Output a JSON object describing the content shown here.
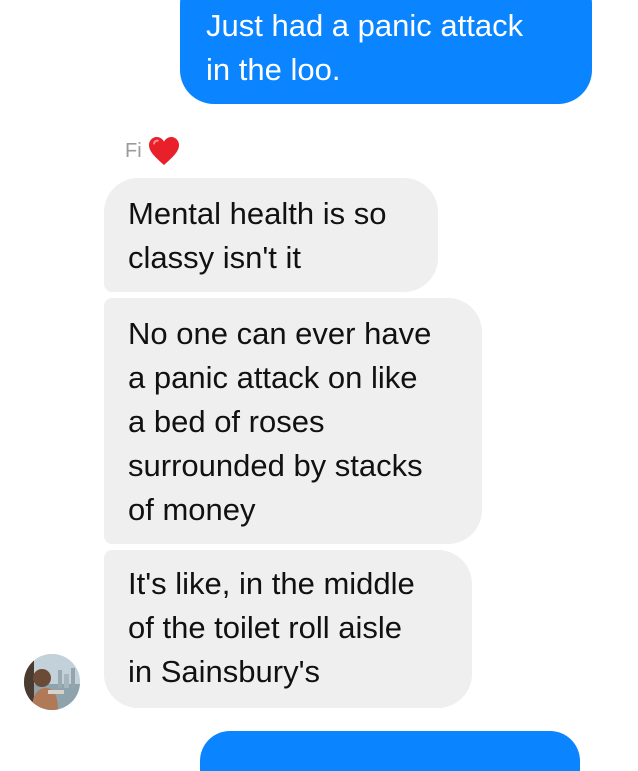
{
  "conversation": {
    "outgoing": [
      {
        "text": "Just had a panic attack\nin the loo."
      }
    ],
    "contact": {
      "name": "Fi",
      "name_icon": "red-heart-emoji",
      "avatar_icon": "contact-avatar-photo"
    },
    "incoming": [
      {
        "text": "Mental health is so\nclassy isn't it"
      },
      {
        "text": "No one can ever have\na panic attack on like\na bed of roses\nsurrounded by stacks\nof money"
      },
      {
        "text": "It's like, in the middle\nof the toilet roll aisle\nin Sainsbury's"
      }
    ]
  },
  "colors": {
    "outgoing_bubble": "#0a84ff",
    "incoming_bubble": "#efefef",
    "sender_name": "#9b9b9b",
    "heart": "#e8202a"
  }
}
